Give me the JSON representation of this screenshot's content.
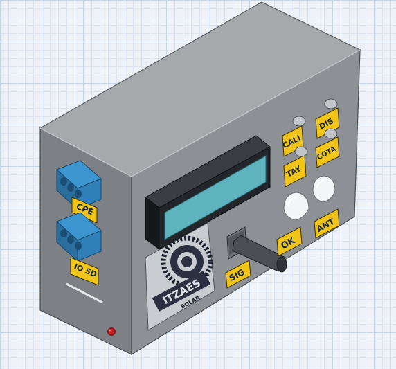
{
  "scene": {
    "background_color": "#eef2f7",
    "grid_color": "#c6d7ea"
  },
  "enclosure": {
    "body_color": "#8a8d91",
    "side_color": "#6c6f73",
    "top_color": "#a5a8ab"
  },
  "display": {
    "bezel_color": "#1f2326",
    "screen_color": "#5fb3bf"
  },
  "left_panel": {
    "terminal_color": "#2f7fb8",
    "labels": {
      "terminal_top": "CPE",
      "terminal_bottom": "IO SD"
    },
    "led_color": "#d0212a"
  },
  "front_panel": {
    "label_color": "#f0c419",
    "buttons": {
      "cal": "CALI",
      "dis": "DIS",
      "tay": "TAY",
      "cota": "COTA",
      "ok": "OK",
      "ant": "ANT",
      "sig": "SIG"
    },
    "logo": {
      "name": "ITZAES",
      "tagline": "SOLAR"
    }
  }
}
